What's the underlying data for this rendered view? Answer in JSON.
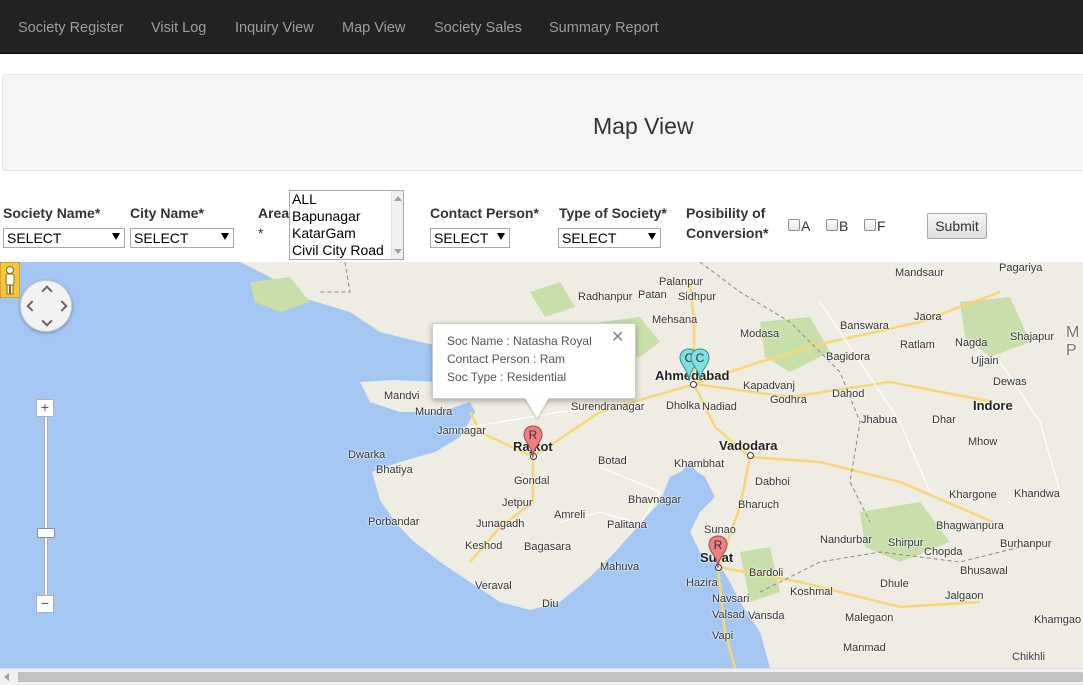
{
  "nav": {
    "items": [
      "Society Register",
      "Visit Log",
      "Inquiry View",
      "Map View",
      "Society Sales",
      "Summary Report"
    ]
  },
  "header": {
    "title": "Map View"
  },
  "filters": {
    "society_name": {
      "label": "Society Name*",
      "value": "SELECT"
    },
    "city_name": {
      "label": "City Name*",
      "value": "SELECT"
    },
    "area": {
      "label": "Area",
      "required_mark": "*",
      "options": [
        "ALL",
        "Bapunagar",
        "KatarGam",
        "Civil City Road"
      ]
    },
    "contact_person": {
      "label": "Contact Person*",
      "value": "SELECT"
    },
    "type_of_society": {
      "label": "Type of Society*",
      "value": "SELECT"
    },
    "conversion": {
      "label_line1": "Posibility of",
      "label_line2": "Conversion*",
      "options": [
        "A",
        "B",
        "F"
      ]
    },
    "submit_label": "Submit"
  },
  "map": {
    "places": {
      "mandsaur": "Mandsaur",
      "pagariya": "Pagariya",
      "palanpur": "Palanpur",
      "radhanpur": "Radhanpur",
      "patan": "Patan",
      "sidhpur": "Sidhpur",
      "mehsana": "Mehsana",
      "modasa": "Modasa",
      "banswara": "Banswara",
      "jaora": "Jaora",
      "shajapur": "Shajapur",
      "ratlam": "Ratlam",
      "nagda": "Nagda",
      "ujjain": "Ujjain",
      "bagidora": "Bagidora",
      "ahmedabad": "Ahmedabad",
      "kapadvanj": "Kapadvanj",
      "dewas": "Dewas",
      "mandvi": "Mandvi",
      "mundra": "Mundra",
      "dholka": "Dholka",
      "nadiad": "Nadiad",
      "godhra": "Godhra",
      "dahod": "Dahod",
      "indore": "Indore",
      "jhabua": "Jhabua",
      "dhar": "Dhar",
      "surendranagar": "Surendranagar",
      "jamnagar": "Jamnagar",
      "rajkot": "Rajkot",
      "vadodara": "Vadodara",
      "mhow": "Mhow",
      "dwarka": "Dwarka",
      "bhatiya": "Bhatiya",
      "botad": "Botad",
      "khambhat": "Khambhat",
      "dabhoi": "Dabhoi",
      "gondal": "Gondal",
      "khargone": "Khargone",
      "khandwa": "Khandwa",
      "porbandar": "Porbandar",
      "jetpur": "Jetpur",
      "bhavnagar": "Bhavnagar",
      "bharuch": "Bharuch",
      "junagadh": "Junagadh",
      "amreli": "Amreli",
      "palitana": "Palitana",
      "bhagwanpura": "Bhagwanpura",
      "sunao": "Sunao",
      "nandurbar": "Nandurbar",
      "shirpur": "Shirpur",
      "chopda": "Chopda",
      "burhanpur": "Burhanpur",
      "keshod": "Keshod",
      "bagasara": "Bagasara",
      "surat": "Surat",
      "mahuva": "Mahuva",
      "bardoli": "Bardoli",
      "bhusawal": "Bhusawal",
      "hazira": "Hazira",
      "veraval": "Veraval",
      "dhule": "Dhule",
      "koshmal": "Koshmal",
      "navsari": "Navsari",
      "jalgaon": "Jalgaon",
      "diu": "Diu",
      "valsad": "Valsad",
      "vansda": "Vansda",
      "malegaon": "Malegaon",
      "khamgaon": "Khamgao",
      "vapi": "Vapi",
      "manmad": "Manmad",
      "chikhli": "Chikhli",
      "state_label": "M",
      "state_label2": "P"
    },
    "markers": [
      {
        "letter": "R",
        "color": "#f08080",
        "name": "rajkot-marker"
      },
      {
        "letter": "C",
        "color": "#7ee0e0",
        "name": "ahmedabad-marker-1"
      },
      {
        "letter": "C",
        "color": "#7ee0e0",
        "name": "ahmedabad-marker-2"
      },
      {
        "letter": "R",
        "color": "#f08080",
        "name": "surat-marker"
      }
    ],
    "infowindow": {
      "soc_name": "Soc Name : Natasha Royal",
      "contact_person": "Contact Person : Ram",
      "soc_type": "Soc Type : Residential",
      "close_symbol": "✕"
    },
    "zoom_in": "+",
    "zoom_out": "−"
  }
}
